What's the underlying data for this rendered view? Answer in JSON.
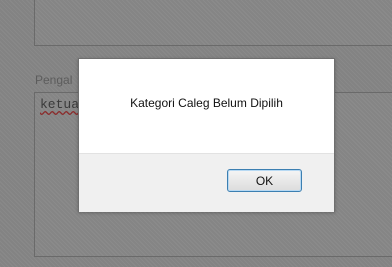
{
  "form": {
    "field_label": "Pengal",
    "textarea_value": "ketua"
  },
  "dialog": {
    "message": "Kategori Caleg Belum Dipilih",
    "ok_label": "OK"
  }
}
